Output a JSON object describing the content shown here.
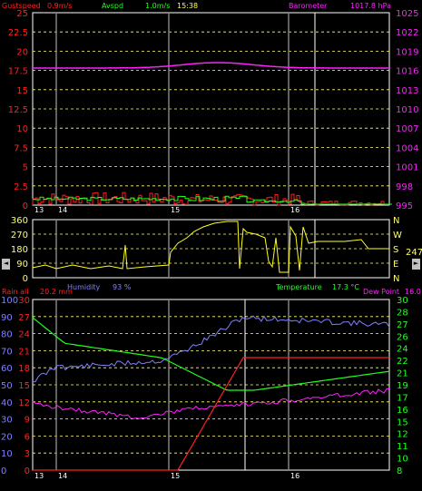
{
  "colors": {
    "background": "#000000",
    "gust": "#ff2020",
    "avg": "#20ff20",
    "baro": "#ff20ff",
    "humidity": "#8080ff",
    "temperature": "#20ff20",
    "dewpoint": "#ff20ff",
    "rain": "#ff2020",
    "direction": "#ffff20",
    "grid": "#ffff80",
    "axis_red": "#ff2020",
    "axis_magenta": "#ff20ff",
    "axis_yellow": "#ffff60",
    "axis_blue": "#8080ff",
    "axis_green": "#20ff20"
  },
  "wind_panel": {
    "gust_label": "Gustspeed",
    "gust_value": "0.9m/s",
    "avg_label": "Avspd",
    "avg_value": "1.0m/s",
    "time": "15:38",
    "baro_label": "Barometer",
    "baro_value": "1017.8 hPa",
    "left_ticks": [
      "25",
      "22.5",
      "20",
      "17.5",
      "15",
      "12.5",
      "10",
      "7.5",
      "5",
      "2.5",
      "0"
    ],
    "right_ticks": [
      "1025",
      "1022",
      "1019",
      "1016",
      "1013",
      "1010",
      "1007",
      "1004",
      "1001",
      "998",
      "995"
    ],
    "x_ticks": [
      "13",
      "14",
      "15",
      "16"
    ]
  },
  "dir_panel": {
    "left_ticks": [
      "360",
      "270",
      "180",
      "90",
      "0"
    ],
    "right_ticks": [
      "N",
      "W",
      "S",
      "E",
      "N"
    ],
    "current_value": "247",
    "scroll_left": "◄",
    "scroll_right": "►"
  },
  "climate_panel": {
    "rain_label": "Rain all",
    "rain_value": "20.2 mm",
    "humidity_label": "Humidity",
    "humidity_value": "93 %",
    "temp_label": "Temperature",
    "temp_value": "17.3 °C",
    "dew_label": "Dew Point",
    "dew_value": "16.0",
    "left_ticks_humidity": [
      "100",
      "90",
      "80",
      "70",
      "60",
      "50",
      "40",
      "30",
      "20",
      "10",
      "0"
    ],
    "left_ticks_rain": [
      "30",
      "27",
      "24",
      "21",
      "18",
      "15",
      "12",
      "9",
      "6",
      "3",
      "0"
    ],
    "right_ticks_temp": [
      "30",
      "28",
      "27",
      "26",
      "24",
      "22",
      "21",
      "19",
      "17",
      "16",
      "15",
      "12",
      "11",
      "10",
      "8"
    ],
    "x_ticks": [
      "13",
      "14",
      "15",
      "16"
    ]
  }
}
